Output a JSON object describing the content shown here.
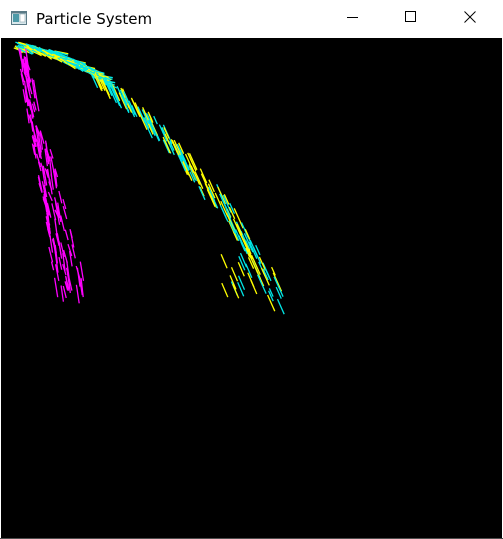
{
  "window": {
    "title": "Particle System",
    "icon": "app-window-icon",
    "controls": {
      "minimize_icon": "minimize-icon",
      "maximize_icon": "maximize-icon",
      "close_icon": "close-icon"
    }
  },
  "scene": {
    "background": "#000000",
    "colors": {
      "stream_a": "#00e5e5",
      "stream_b": "#ffff00",
      "stream_c": "#ff00ff"
    }
  }
}
